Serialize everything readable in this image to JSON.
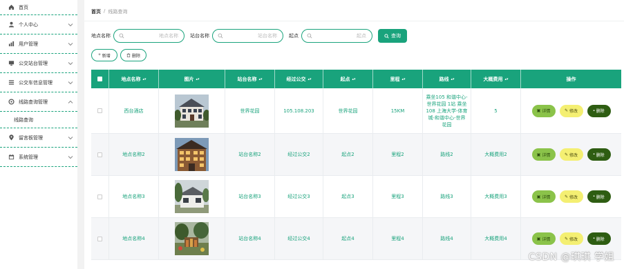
{
  "sidebar": {
    "items": [
      {
        "label": "首页",
        "icon": "home-icon"
      },
      {
        "label": "个人中心",
        "icon": "user-icon"
      },
      {
        "label": "用户管理",
        "icon": "chart-icon"
      },
      {
        "label": "公交站台管理",
        "icon": "monitor-icon"
      },
      {
        "label": "公交车信息管理",
        "icon": "list-icon"
      },
      {
        "label": "线路查询管理",
        "icon": "gear-icon",
        "expanded": true
      },
      {
        "label": "留言板管理",
        "icon": "location-icon"
      },
      {
        "label": "系统管理",
        "icon": "calendar-icon"
      }
    ],
    "sub_items": [
      {
        "label": "线路查询"
      }
    ]
  },
  "breadcrumb": {
    "home": "首页",
    "sep": "/",
    "current": "线路查询"
  },
  "search": {
    "fields": [
      {
        "label": "地点名称",
        "placeholder": "地点名称"
      },
      {
        "label": "站台名称",
        "placeholder": "站台名称"
      },
      {
        "label": "起点",
        "placeholder": "起点"
      }
    ],
    "button": "查询"
  },
  "actions": {
    "add": "新增",
    "delete": "删除"
  },
  "table": {
    "headers": [
      "地点名称",
      "图片",
      "站台名称",
      "经过公交",
      "起点",
      "里程",
      "路线",
      "大概费用",
      "操作"
    ],
    "rows": [
      {
        "place": "西台酒店",
        "image": "hotel-photo",
        "station": "世界花园",
        "bus": "105.108.203",
        "start": "世界花园",
        "mileage": "15KM",
        "route": "乘坐105 和谐中心-世界花园 1站 乘坐108 上海大学-体育城-和谐中心-世界花园",
        "cost": "5"
      },
      {
        "place": "地点名称2",
        "image": "building-photo",
        "station": "站台名称2",
        "bus": "经过公交2",
        "start": "起点2",
        "mileage": "里程2",
        "route": "路线2",
        "cost": "大概费用2"
      },
      {
        "place": "地点名称3",
        "image": "house-photo",
        "station": "站台名称3",
        "bus": "经过公交3",
        "start": "起点3",
        "mileage": "里程3",
        "route": "路线3",
        "cost": "大概费用3"
      },
      {
        "place": "地点名称4",
        "image": "garden-photo",
        "station": "站台名称4",
        "bus": "经过公交4",
        "start": "起点4",
        "mileage": "里程4",
        "route": "路线4",
        "cost": "大概费用4"
      }
    ],
    "ops": {
      "detail": "详情",
      "edit": "修改",
      "delete": "删除"
    }
  },
  "watermark": "CSDN @琪琪 学姐",
  "colors": {
    "accent": "#19a37c",
    "detail": "#8bc34a",
    "edit": "#f4ef72",
    "delete": "#2e5d12"
  }
}
